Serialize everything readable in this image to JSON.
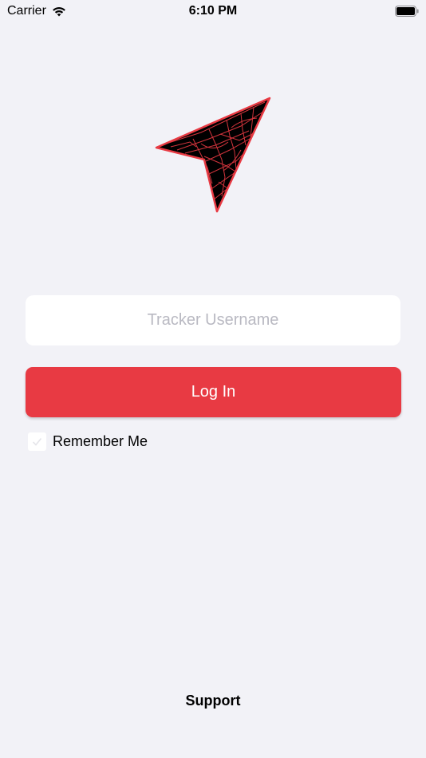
{
  "status_bar": {
    "carrier": "Carrier",
    "time": "6:10 PM",
    "wifi_icon": "wifi-icon",
    "battery_icon": "battery-full-icon"
  },
  "logo": {
    "icon": "navigation-arrow-map-icon",
    "fill_color": "#000000",
    "line_color": "#e83a43"
  },
  "login_form": {
    "username_placeholder": "Tracker Username",
    "username_value": "",
    "login_label": "Log In",
    "remember_label": "Remember Me",
    "remember_checked": false
  },
  "footer": {
    "support_label": "Support"
  },
  "colors": {
    "background": "#f2f2f7",
    "accent": "#e83a43",
    "field_background": "#ffffff",
    "placeholder": "#b9b9c2"
  }
}
